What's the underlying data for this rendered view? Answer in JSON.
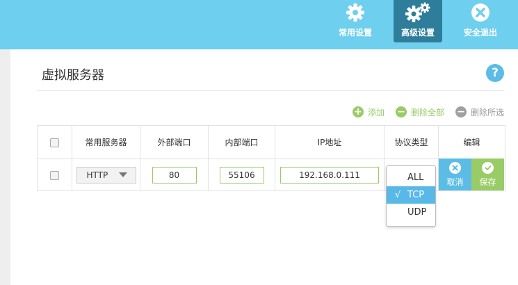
{
  "nav": {
    "common_settings": "常用设置",
    "advanced_settings": "高级设置",
    "safe_exit": "安全退出"
  },
  "page": {
    "title": "虚拟服务器",
    "help": "?"
  },
  "actions": {
    "add": "添加",
    "delete_all": "删除全部",
    "delete_selected": "删除所选"
  },
  "table": {
    "headers": [
      "常用服务器",
      "外部端口",
      "内部端口",
      "IP地址",
      "协议类型",
      "编辑"
    ],
    "row": {
      "server": "HTTP",
      "external_port": "80",
      "internal_port": "55106",
      "ip": "192.168.0.111",
      "cancel": "取消",
      "save": "保存"
    }
  },
  "protocol_dropdown": {
    "options": [
      "ALL",
      "TCP",
      "UDP"
    ],
    "selected": "TCP",
    "check_mark": "√"
  },
  "colors": {
    "topbar": "#6ecfee",
    "nav_active": "#2e7d9b",
    "help": "#5bbde5",
    "add_icon": "#99cc66",
    "delete_all_icon": "#99cc66",
    "delete_selected_icon": "#a0a0a0",
    "cancel_button": "#5bbde5",
    "save_button": "#99cc66",
    "dropdown_selected": "#58b8e7"
  }
}
